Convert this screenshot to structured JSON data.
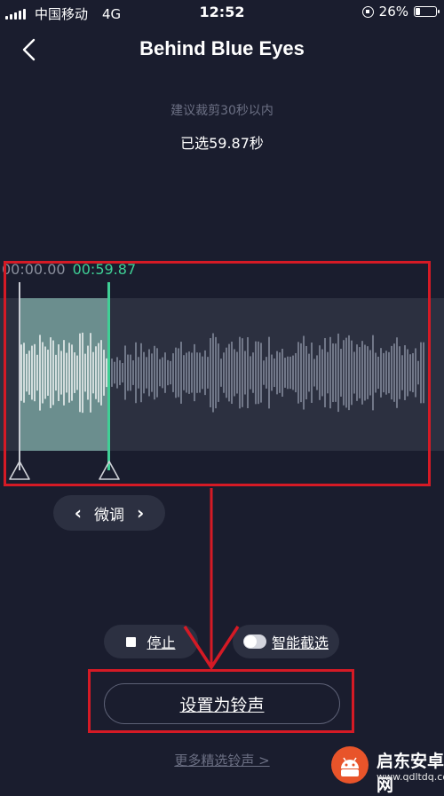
{
  "status_bar": {
    "carrier": "中国移动",
    "network": "4G",
    "time": "12:52",
    "battery": "26%",
    "battery_level": 0.26
  },
  "header": {
    "title": "Behind Blue Eyes",
    "back_icon": "chevron-left-icon"
  },
  "trim": {
    "hint": "建议裁剪30秒以内",
    "selected_label": "已选59.87秒",
    "start_time": "00:00.00",
    "end_time": "00:59.87"
  },
  "fine_tune": {
    "label": "微调",
    "prev_icon": "chevron-left-icon",
    "next_icon": "chevron-right-icon"
  },
  "controls": {
    "stop_label": "停止",
    "smart_select_label": "智能截选",
    "smart_select_on": false
  },
  "actions": {
    "set_ringtone_label": "设置为铃声",
    "more_label": "更多精选铃声 >"
  },
  "watermark": {
    "name": "启东安卓网",
    "url": "www.qdltdq.com"
  },
  "colors": {
    "background": "#1a1d2e",
    "accent": "#3fcf95",
    "annotation": "#d51a25"
  }
}
